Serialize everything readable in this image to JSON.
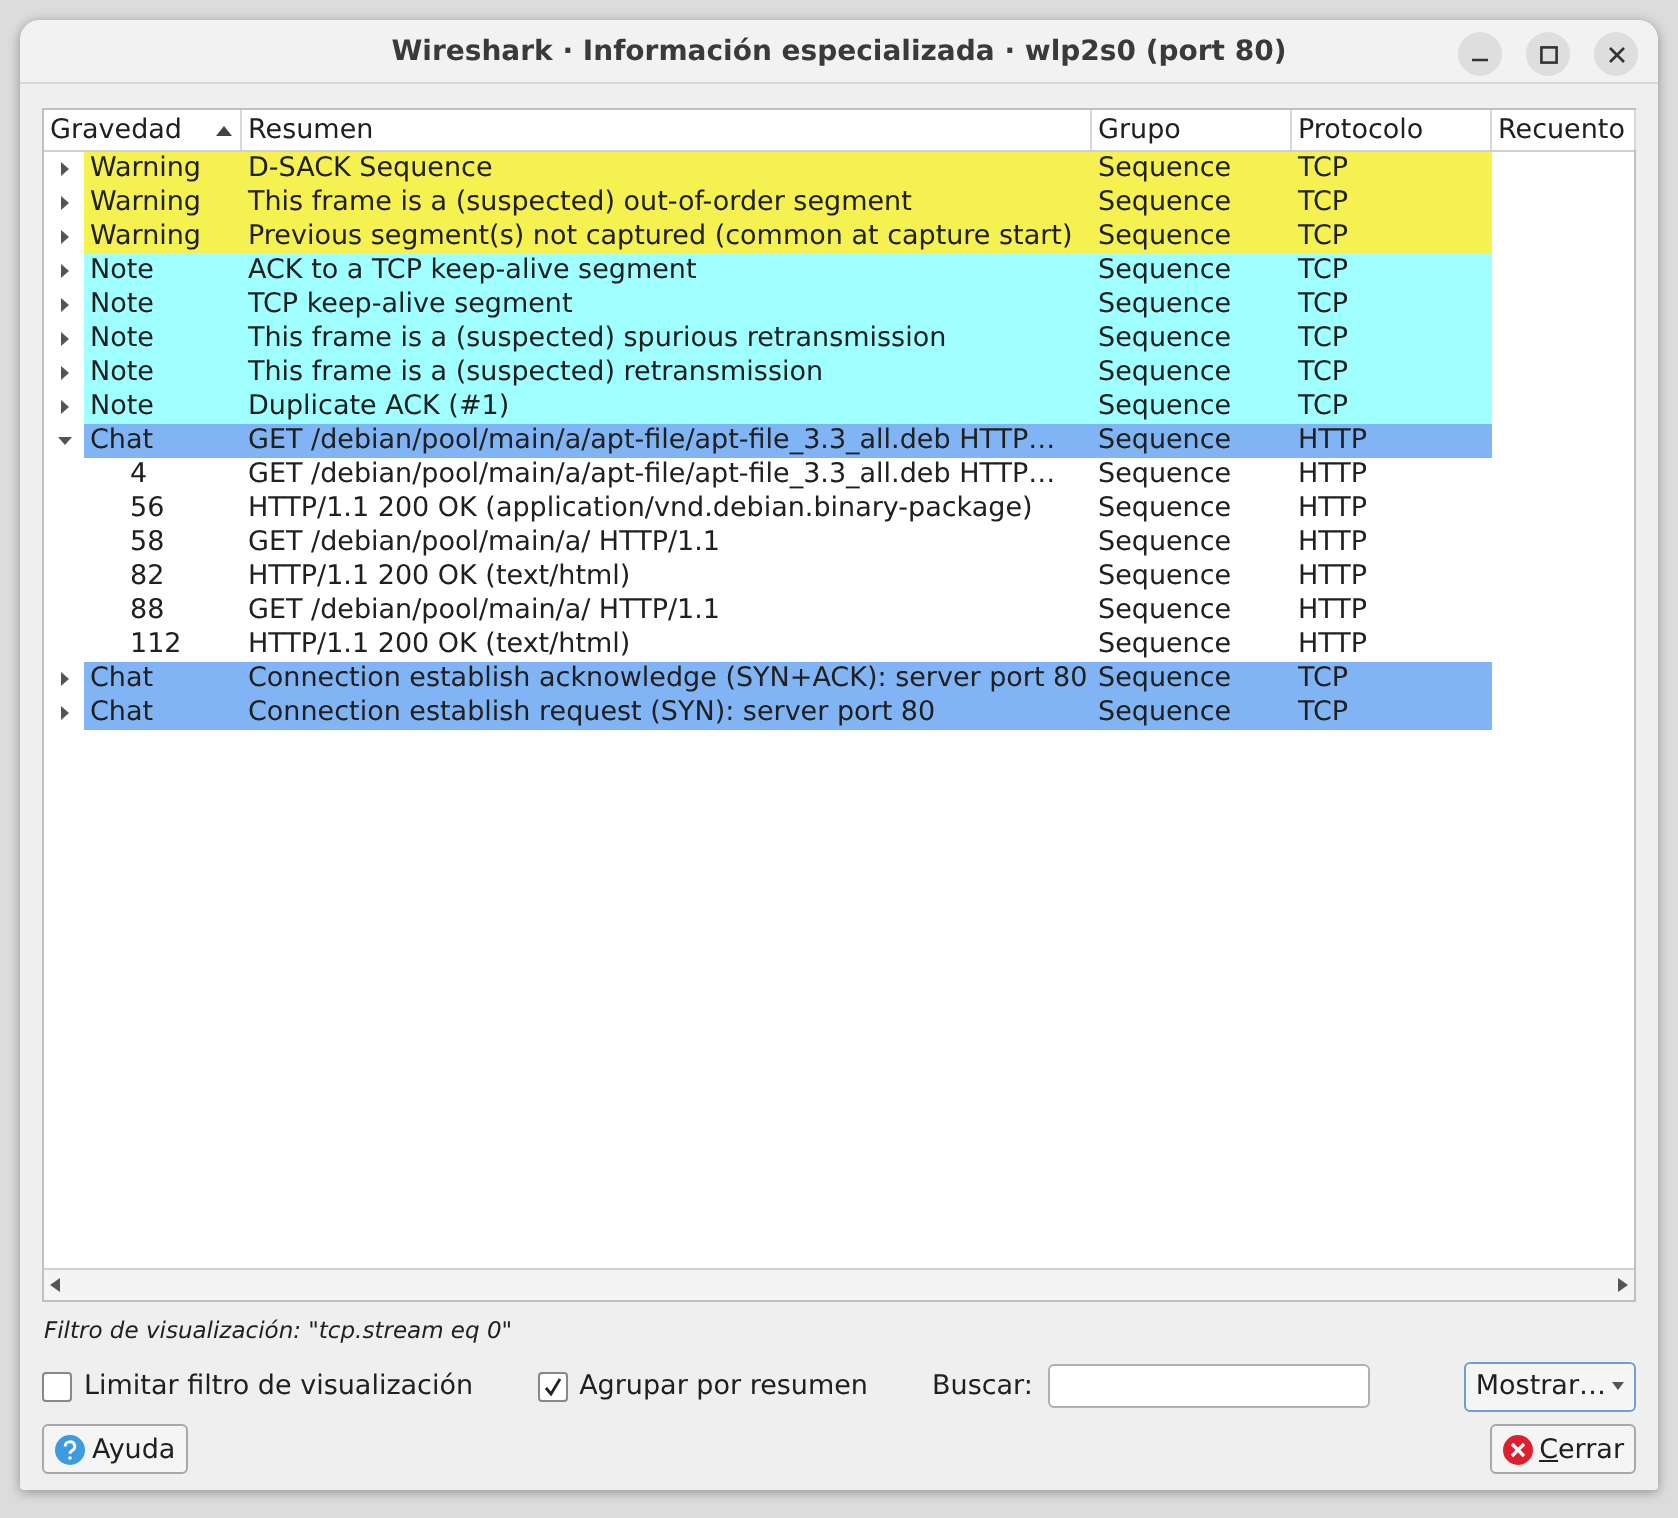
{
  "window": {
    "title": "Wireshark · Información especializada · wlp2s0 (port 80)"
  },
  "table": {
    "columns": [
      {
        "label": "Gravedad",
        "sorted": true
      },
      {
        "label": "Resumen",
        "sorted": false
      },
      {
        "label": "Grupo",
        "sorted": false
      },
      {
        "label": "Protocolo",
        "sorted": false
      },
      {
        "label": "Recuento",
        "sorted": false
      }
    ],
    "rows": [
      {
        "severity": "Warning",
        "color": "#f4f150",
        "expanded": false,
        "summary": "D-SACK Sequence",
        "group": "Sequence",
        "protocol": "TCP"
      },
      {
        "severity": "Warning",
        "color": "#f4f150",
        "expanded": false,
        "summary": "This frame is a (suspected) out-of-order segment",
        "group": "Sequence",
        "protocol": "TCP"
      },
      {
        "severity": "Warning",
        "color": "#f4f150",
        "expanded": false,
        "summary": "Previous segment(s) not captured (common at capture start)",
        "group": "Sequence",
        "protocol": "TCP"
      },
      {
        "severity": "Note",
        "color": "#a0ffff",
        "expanded": false,
        "summary": "ACK to a TCP keep-alive segment",
        "group": "Sequence",
        "protocol": "TCP"
      },
      {
        "severity": "Note",
        "color": "#a0ffff",
        "expanded": false,
        "summary": "TCP keep-alive segment",
        "group": "Sequence",
        "protocol": "TCP"
      },
      {
        "severity": "Note",
        "color": "#a0ffff",
        "expanded": false,
        "summary": "This frame is a (suspected) spurious retransmission",
        "group": "Sequence",
        "protocol": "TCP"
      },
      {
        "severity": "Note",
        "color": "#a0ffff",
        "expanded": false,
        "summary": "This frame is a (suspected) retransmission",
        "group": "Sequence",
        "protocol": "TCP"
      },
      {
        "severity": "Note",
        "color": "#a0ffff",
        "expanded": false,
        "summary": "Duplicate ACK (#1)",
        "group": "Sequence",
        "protocol": "TCP"
      },
      {
        "severity": "Chat",
        "color": "#80b4f4",
        "expanded": true,
        "summary": "GET /debian/pool/main/a/apt-file/apt-file_3.3_all.deb HTTP…",
        "group": "Sequence",
        "protocol": "HTTP",
        "children": [
          {
            "packet": "4",
            "summary": "GET /debian/pool/main/a/apt-file/apt-file_3.3_all.deb HTTP…",
            "group": "Sequence",
            "protocol": "HTTP"
          },
          {
            "packet": "56",
            "summary": "HTTP/1.1 200 OK (application/vnd.debian.binary-package)",
            "group": "Sequence",
            "protocol": "HTTP"
          },
          {
            "packet": "58",
            "summary": "GET /debian/pool/main/a/ HTTP/1.1",
            "group": "Sequence",
            "protocol": "HTTP"
          },
          {
            "packet": "82",
            "summary": "HTTP/1.1 200 OK (text/html)",
            "group": "Sequence",
            "protocol": "HTTP"
          },
          {
            "packet": "88",
            "summary": "GET /debian/pool/main/a/ HTTP/1.1",
            "group": "Sequence",
            "protocol": "HTTP"
          },
          {
            "packet": "112",
            "summary": "HTTP/1.1 200 OK (text/html)",
            "group": "Sequence",
            "protocol": "HTTP"
          }
        ]
      },
      {
        "severity": "Chat",
        "color": "#80b4f4",
        "expanded": false,
        "summary": "Connection establish acknowledge (SYN+ACK): server port 80",
        "group": "Sequence",
        "protocol": "TCP"
      },
      {
        "severity": "Chat",
        "color": "#80b4f4",
        "expanded": false,
        "summary": "Connection establish request (SYN): server port 80",
        "group": "Sequence",
        "protocol": "TCP"
      }
    ]
  },
  "filter_label": "Filtro de visualización: \"tcp.stream eq 0\"",
  "limit_filter": {
    "label": "Limitar filtro de visualización",
    "checked": false
  },
  "group_by_summary": {
    "label": "Agrupar por resumen",
    "checked": true
  },
  "search": {
    "label": "Buscar:"
  },
  "show_button": "Mostrar…",
  "help_button": "Ayuda",
  "close_button": {
    "mnemonic": "C",
    "rest": "errar"
  }
}
